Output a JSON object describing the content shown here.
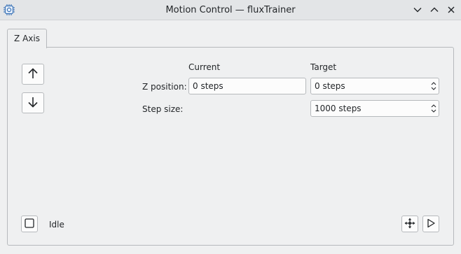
{
  "window": {
    "title": "Motion Control — fluxTrainer",
    "icons": [
      "app-chip-icon",
      "minimize-chevron-icon",
      "maximize-chevron-icon",
      "close-icon"
    ]
  },
  "tabs": [
    {
      "label": "Z Axis",
      "active": true
    }
  ],
  "z_axis": {
    "up_button_icon": "arrow-up-icon",
    "down_button_icon": "arrow-down-icon",
    "column_current": "Current",
    "column_target": "Target",
    "z_position_label": "Z position:",
    "z_position_current": "0 steps",
    "z_position_target": "0 steps",
    "step_size_label": "Step size:",
    "step_size_target": "1000 steps"
  },
  "status": {
    "checkbox_checked": false,
    "text": "Idle",
    "home_button_icon": "move-all-icon",
    "run_button_icon": "play-icon"
  },
  "colors": {
    "background": "#eff0f1",
    "titlebar": "#e3e5e7",
    "border": "#b6b9bc",
    "text": "#232629"
  }
}
